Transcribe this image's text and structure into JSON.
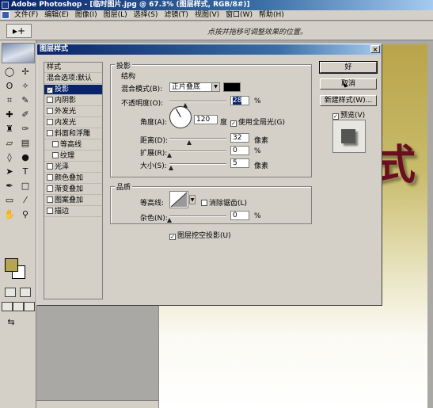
{
  "app": {
    "title": "Adobe Photoshop - [临时图片.jpg @ 67.3% (图层样式, RGB/8#)]",
    "menu": [
      "文件(F)",
      "编辑(E)",
      "图像(I)",
      "图层(L)",
      "选择(S)",
      "滤镜(T)",
      "视图(V)",
      "窗口(W)",
      "帮助(H)"
    ],
    "options_hint": "点按并拖移可调整效果的位置。",
    "tool_preset": "▸+"
  },
  "toolbox": {
    "fg_color": "#b5a64f",
    "bg_color": "#ffffff"
  },
  "canvas": {
    "char": "式",
    "char_color": "#6a0f20"
  },
  "dialog": {
    "title": "图层样式",
    "close": "×",
    "styles": [
      {
        "label": "样式",
        "checkbox": false,
        "checked": false
      },
      {
        "label": "混合选项:默认",
        "checkbox": false,
        "checked": false
      },
      {
        "label": "投影",
        "checkbox": true,
        "checked": true,
        "selected": true
      },
      {
        "label": "内阴影",
        "checkbox": true,
        "checked": false
      },
      {
        "label": "外发光",
        "checkbox": true,
        "checked": false
      },
      {
        "label": "内发光",
        "checkbox": true,
        "checked": false
      },
      {
        "label": "斜面和浮雕",
        "checkbox": true,
        "checked": false
      },
      {
        "label": "等高线",
        "checkbox": true,
        "checked": false,
        "indent": true
      },
      {
        "label": "纹理",
        "checkbox": true,
        "checked": false,
        "indent": true
      },
      {
        "label": "光泽",
        "checkbox": true,
        "checked": false
      },
      {
        "label": "颜色叠加",
        "checkbox": true,
        "checked": false
      },
      {
        "label": "渐变叠加",
        "checkbox": true,
        "checked": false
      },
      {
        "label": "图案叠加",
        "checkbox": true,
        "checked": false
      },
      {
        "label": "描边",
        "checkbox": true,
        "checked": false
      }
    ],
    "drop_shadow": {
      "group_title": "投影",
      "structure_title": "结构",
      "blend_mode_label": "混合模式(B):",
      "blend_mode_value": "正片叠底",
      "shadow_color": "#000000",
      "opacity_label": "不透明度(O):",
      "opacity_value": "28",
      "opacity_unit": "%",
      "opacity_fraction": 0.28,
      "angle_label": "角度(A):",
      "angle_value": "120",
      "angle_unit": "度",
      "global_light_label": "使用全局光(G)",
      "global_light_checked": true,
      "distance_label": "距离(D):",
      "distance_value": "32",
      "distance_unit": "像素",
      "spread_label": "扩展(R):",
      "spread_value": "0",
      "spread_unit": "%",
      "size_label": "大小(S):",
      "size_value": "5",
      "size_unit": "像素",
      "quality_title": "品质",
      "contour_label": "等高线:",
      "antialias_label": "消除锯齿(L)",
      "antialias_checked": false,
      "noise_label": "杂色(N):",
      "noise_value": "0",
      "noise_unit": "%",
      "knockout_label": "图层挖空投影(U)",
      "knockout_checked": true
    },
    "buttons": {
      "ok": "好",
      "cancel": "取消",
      "new_style": "新建样式(W)...",
      "preview_label": "预览(V)",
      "preview_checked": true
    }
  }
}
